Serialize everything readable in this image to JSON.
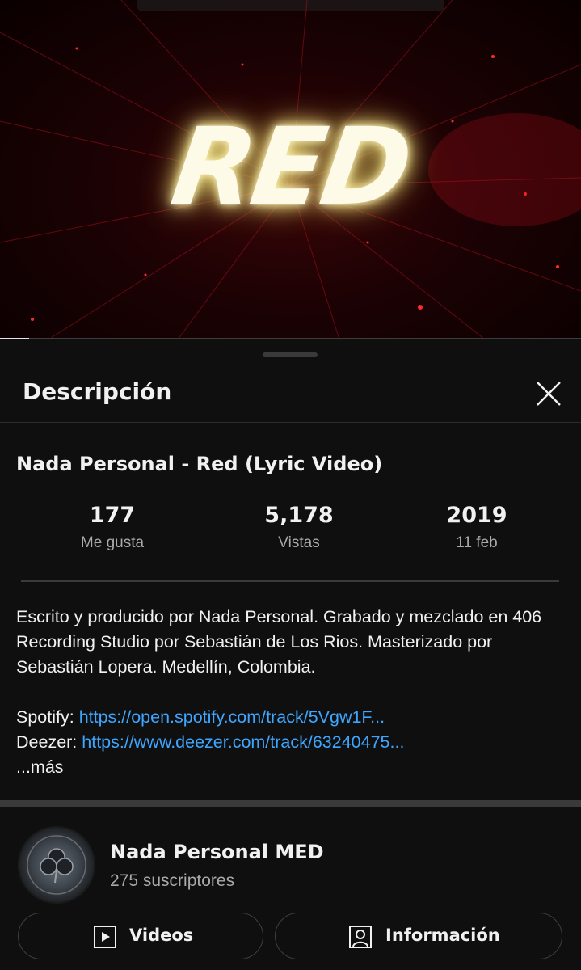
{
  "video": {
    "title_art": "RED",
    "progress": 0.05
  },
  "sheet": {
    "title": "Descripción",
    "close_icon": "close-icon"
  },
  "video_name": "Nada Personal - Red (Lyric Video)",
  "stats": [
    {
      "value": "177",
      "label": "Me gusta"
    },
    {
      "value": "5,178",
      "label": "Vistas"
    },
    {
      "value": "2019",
      "label": "11 feb"
    }
  ],
  "description": {
    "text": "Escrito y producido por Nada Personal. Grabado y mezclado en 406 Recording Studio por Sebastián de Los Rios. Masterizado por Sebastián Lopera. Medellín, Colombia.",
    "spotify_label": "Spotify: ",
    "spotify_url": "https://open.spotify.com/track/5Vgw1F...",
    "deezer_label": "Deezer: ",
    "deezer_url": "https://www.deezer.com/track/63240475...",
    "more": "...más"
  },
  "channel": {
    "name": "Nada Personal MED",
    "subscribers": "275 suscriptores"
  },
  "buttons": {
    "videos": "Videos",
    "info": "Información"
  },
  "colors": {
    "background": "#0f0f0f",
    "link": "#3ea6ff",
    "secondary_text": "#aaaaaa"
  }
}
